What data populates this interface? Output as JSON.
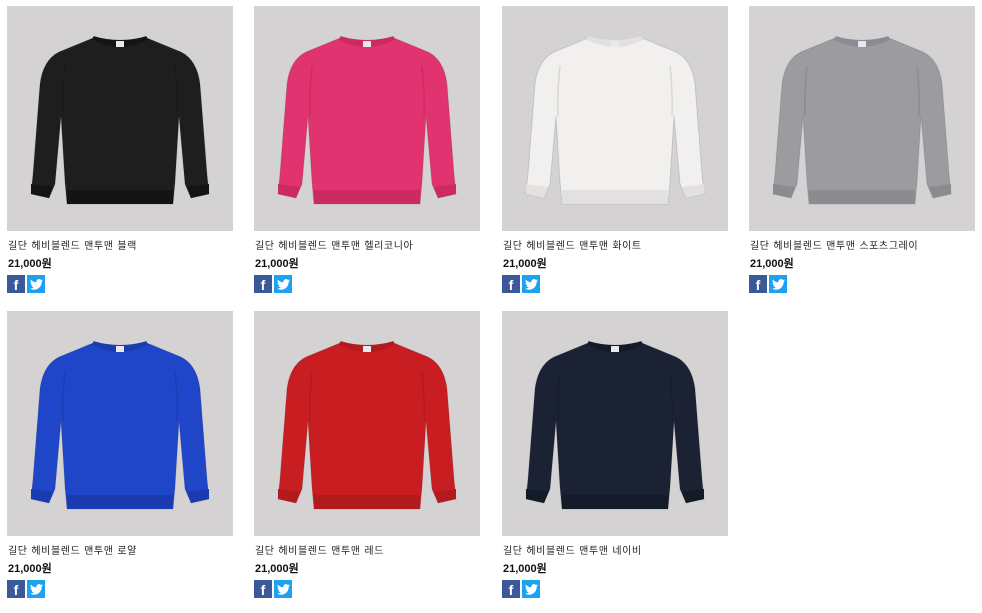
{
  "products": [
    {
      "title": "길단 헤비블렌드 맨투맨 블랙",
      "price": "21,000원",
      "color": "#1e1e1e",
      "rib": "#141414"
    },
    {
      "title": "길단 헤비블렌드 맨투맨 헬리코니아",
      "price": "21,000원",
      "color": "#e0336f",
      "rib": "#cc2a62"
    },
    {
      "title": "길단 헤비블렌드 맨투맨 화이트",
      "price": "21,000원",
      "color": "#f1f0ee",
      "rib": "#e2e1df"
    },
    {
      "title": "길단 헤비블렌드 맨투맨 스포츠그레이",
      "price": "21,000원",
      "color": "#9c9b9f",
      "rib": "#8c8b8f"
    },
    {
      "title": "길단 헤비블렌드 맨투맨 로얄",
      "price": "21,000원",
      "color": "#1f46c9",
      "rib": "#1a3cb0"
    },
    {
      "title": "길단 헤비블렌드 맨투맨 레드",
      "price": "21,000원",
      "color": "#c81e22",
      "rib": "#b31a1d"
    },
    {
      "title": "길단 헤비블렌드 맨투맨 네이비",
      "price": "21,000원",
      "color": "#1a2233",
      "rib": "#131a28"
    }
  ],
  "share": {
    "facebook_icon": "f",
    "twitter_icon": "bird"
  }
}
